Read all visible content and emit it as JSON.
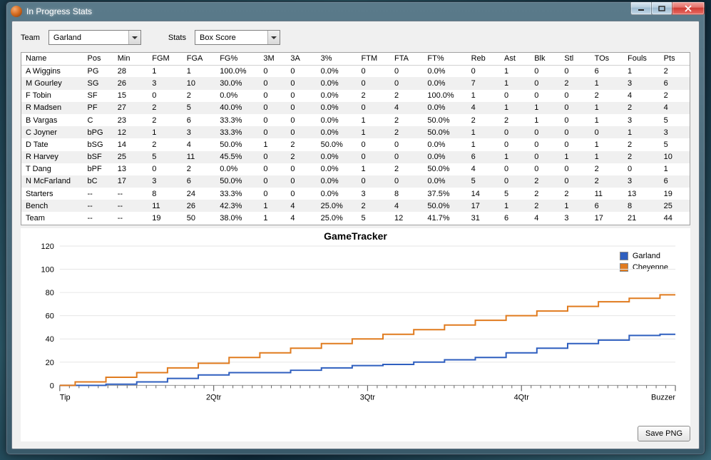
{
  "window": {
    "title": "In Progress Stats"
  },
  "toolbar": {
    "team_label": "Team",
    "team_value": "Garland",
    "stats_label": "Stats",
    "stats_value": "Box Score"
  },
  "grid": {
    "columns": [
      "Name",
      "Pos",
      "Min",
      "FGM",
      "FGA",
      "FG%",
      "3M",
      "3A",
      "3%",
      "FTM",
      "FTA",
      "FT%",
      "Reb",
      "Ast",
      "Blk",
      "Stl",
      "TOs",
      "Fouls",
      "Pts"
    ],
    "rows": [
      [
        "A Wiggins",
        "PG",
        "28",
        "1",
        "1",
        "100.0%",
        "0",
        "0",
        "0.0%",
        "0",
        "0",
        "0.0%",
        "0",
        "1",
        "0",
        "0",
        "6",
        "1",
        "2"
      ],
      [
        "M Gourley",
        "SG",
        "26",
        "3",
        "10",
        "30.0%",
        "0",
        "0",
        "0.0%",
        "0",
        "0",
        "0.0%",
        "7",
        "1",
        "0",
        "2",
        "1",
        "3",
        "6"
      ],
      [
        "F Tobin",
        "SF",
        "15",
        "0",
        "2",
        "0.0%",
        "0",
        "0",
        "0.0%",
        "2",
        "2",
        "100.0%",
        "1",
        "0",
        "0",
        "0",
        "2",
        "4",
        "2"
      ],
      [
        "R Madsen",
        "PF",
        "27",
        "2",
        "5",
        "40.0%",
        "0",
        "0",
        "0.0%",
        "0",
        "4",
        "0.0%",
        "4",
        "1",
        "1",
        "0",
        "1",
        "2",
        "4"
      ],
      [
        "B Vargas",
        "C",
        "23",
        "2",
        "6",
        "33.3%",
        "0",
        "0",
        "0.0%",
        "1",
        "2",
        "50.0%",
        "2",
        "2",
        "1",
        "0",
        "1",
        "3",
        "5"
      ],
      [
        "C Joyner",
        "bPG",
        "12",
        "1",
        "3",
        "33.3%",
        "0",
        "0",
        "0.0%",
        "1",
        "2",
        "50.0%",
        "1",
        "0",
        "0",
        "0",
        "0",
        "1",
        "3"
      ],
      [
        "D Tate",
        "bSG",
        "14",
        "2",
        "4",
        "50.0%",
        "1",
        "2",
        "50.0%",
        "0",
        "0",
        "0.0%",
        "1",
        "0",
        "0",
        "0",
        "1",
        "2",
        "5"
      ],
      [
        "R Harvey",
        "bSF",
        "25",
        "5",
        "11",
        "45.5%",
        "0",
        "2",
        "0.0%",
        "0",
        "0",
        "0.0%",
        "6",
        "1",
        "0",
        "1",
        "1",
        "2",
        "10"
      ],
      [
        "T Dang",
        "bPF",
        "13",
        "0",
        "2",
        "0.0%",
        "0",
        "0",
        "0.0%",
        "1",
        "2",
        "50.0%",
        "4",
        "0",
        "0",
        "0",
        "2",
        "0",
        "1"
      ],
      [
        "N McFarland",
        "bC",
        "17",
        "3",
        "6",
        "50.0%",
        "0",
        "0",
        "0.0%",
        "0",
        "0",
        "0.0%",
        "5",
        "0",
        "2",
        "0",
        "2",
        "3",
        "6"
      ],
      [
        "Starters",
        "--",
        "--",
        "8",
        "24",
        "33.3%",
        "0",
        "0",
        "0.0%",
        "3",
        "8",
        "37.5%",
        "14",
        "5",
        "2",
        "2",
        "11",
        "13",
        "19"
      ],
      [
        "Bench",
        "--",
        "--",
        "11",
        "26",
        "42.3%",
        "1",
        "4",
        "25.0%",
        "2",
        "4",
        "50.0%",
        "17",
        "1",
        "2",
        "1",
        "6",
        "8",
        "25"
      ],
      [
        "Team",
        "--",
        "--",
        "19",
        "50",
        "38.0%",
        "1",
        "4",
        "25.0%",
        "5",
        "12",
        "41.7%",
        "31",
        "6",
        "4",
        "3",
        "17",
        "21",
        "44"
      ]
    ]
  },
  "chart_data": {
    "type": "line",
    "title": "GameTracker",
    "xlabel": "",
    "ylabel": "",
    "ylim": [
      0,
      120
    ],
    "yticks": [
      0,
      20,
      40,
      60,
      80,
      100,
      120
    ],
    "xticks": [
      "Tip",
      "2Qtr",
      "3Qtr",
      "4Qtr",
      "Buzzer"
    ],
    "xtick_pos": [
      0,
      0.25,
      0.5,
      0.75,
      1.0
    ],
    "series": [
      {
        "name": "Garland",
        "color": "#2f5fbf",
        "x": [
          0,
          0.05,
          0.1,
          0.15,
          0.2,
          0.25,
          0.3,
          0.35,
          0.4,
          0.45,
          0.5,
          0.55,
          0.6,
          0.65,
          0.7,
          0.75,
          0.8,
          0.85,
          0.9,
          0.95,
          1.0
        ],
        "y": [
          0,
          0,
          1,
          3,
          6,
          9,
          11,
          11,
          13,
          15,
          17,
          18,
          20,
          22,
          24,
          28,
          32,
          36,
          39,
          43,
          44
        ]
      },
      {
        "name": "Cheyenne",
        "color": "#e07b1f",
        "x": [
          0,
          0.05,
          0.1,
          0.15,
          0.2,
          0.25,
          0.3,
          0.35,
          0.4,
          0.45,
          0.5,
          0.55,
          0.6,
          0.65,
          0.7,
          0.75,
          0.8,
          0.85,
          0.9,
          0.95,
          1.0
        ],
        "y": [
          0,
          3,
          7,
          11,
          15,
          19,
          24,
          28,
          32,
          36,
          40,
          44,
          48,
          52,
          56,
          60,
          64,
          68,
          72,
          75,
          78
        ]
      }
    ]
  },
  "buttons": {
    "save_png": "Save PNG"
  }
}
